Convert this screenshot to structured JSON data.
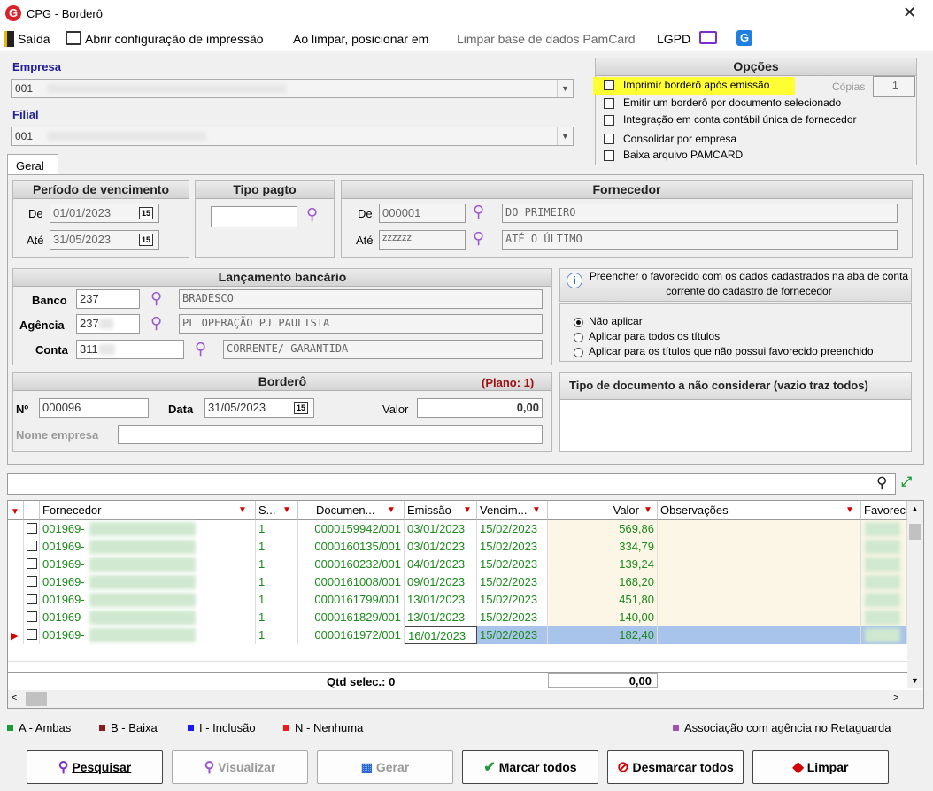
{
  "window": {
    "title": "CPG - Borderô",
    "close": "✕"
  },
  "menu": {
    "exit": "Saída",
    "print_config": "Abrir configuração de impressão",
    "on_clear": "Ao limpar, posicionar em",
    "clear_pamcard": "Limpar base de dados PamCard",
    "lgpd": "LGPD"
  },
  "empresa": {
    "label": "Empresa",
    "value": "001"
  },
  "filial": {
    "label": "Filial",
    "value": "001"
  },
  "opcoes": {
    "title": "Opções",
    "items": [
      "Imprimir borderô após emissão",
      "Emitir um borderô por documento selecionado",
      "Integração em conta contábil única de fornecedor",
      "Consolidar por empresa",
      "Baixa arquivo PAMCARD"
    ],
    "copias_label": "Cópias",
    "copias_value": "1"
  },
  "tabs": {
    "geral": "Geral"
  },
  "periodo": {
    "title": "Período de vencimento",
    "de_label": "De",
    "de_value": "01/01/2023",
    "ate_label": "Até",
    "ate_value": "31/05/2023",
    "cal": "15"
  },
  "tipo_pagto": {
    "title": "Tipo pagto"
  },
  "fornecedor": {
    "title": "Fornecedor",
    "de_label": "De",
    "de_code": "000001",
    "de_name": "DO PRIMEIRO",
    "ate_label": "Até",
    "ate_code": "zzzzzz",
    "ate_name": "ATÉ O ÚLTIMO"
  },
  "lancamento": {
    "title": "Lançamento bancário",
    "banco_label": "Banco",
    "banco_code": "237",
    "banco_name": "BRADESCO",
    "agencia_label": "Agência",
    "agencia_code": "237",
    "agencia_name": "PL OPERAÇÃO PJ PAULISTA",
    "conta_label": "Conta",
    "conta_code": "311",
    "conta_name": "CORRENTE/ GARANTIDA"
  },
  "favorecido": {
    "info": "Preencher o favorecido com os dados cadastrados na aba de conta corrente do cadastro de fornecedor",
    "options": [
      "Não aplicar",
      "Aplicar para todos os títulos",
      "Aplicar para os títulos que não possui favorecido preenchido"
    ]
  },
  "bordero": {
    "title": "Borderô",
    "plano": "(Plano: 1)",
    "num_label": "Nº",
    "num_value": "000096",
    "data_label": "Data",
    "data_value": "31/05/2023",
    "valor_label": "Valor",
    "valor_value": "0,00",
    "nome_empresa_label": "Nome empresa"
  },
  "tipo_doc": {
    "title": "Tipo de documento a não considerar (vazio traz todos)"
  },
  "grid": {
    "headers": {
      "fornecedor": "Fornecedor",
      "s": "S...",
      "documento": "Documen...",
      "emissao": "Emissão",
      "vencimento": "Vencim...",
      "valor": "Valor",
      "observacoes": "Observações",
      "favorecido": "Favorec"
    },
    "rows": [
      {
        "fornecedor": "001969-",
        "s": "1",
        "documento": "0000159942/001",
        "emissao": "03/01/2023",
        "vencimento": "15/02/2023",
        "valor": "569,86"
      },
      {
        "fornecedor": "001969-",
        "s": "1",
        "documento": "0000160135/001",
        "emissao": "03/01/2023",
        "vencimento": "15/02/2023",
        "valor": "334,79"
      },
      {
        "fornecedor": "001969-",
        "s": "1",
        "documento": "0000160232/001",
        "emissao": "04/01/2023",
        "vencimento": "15/02/2023",
        "valor": "139,24"
      },
      {
        "fornecedor": "001969-",
        "s": "1",
        "documento": "0000161008/001",
        "emissao": "09/01/2023",
        "vencimento": "15/02/2023",
        "valor": "168,20"
      },
      {
        "fornecedor": "001969-",
        "s": "1",
        "documento": "0000161799/001",
        "emissao": "13/01/2023",
        "vencimento": "15/02/2023",
        "valor": "451,80"
      },
      {
        "fornecedor": "001969-",
        "s": "1",
        "documento": "0000161829/001",
        "emissao": "13/01/2023",
        "vencimento": "15/02/2023",
        "valor": "140,00"
      },
      {
        "fornecedor": "001969-",
        "s": "1",
        "documento": "0000161972/001",
        "emissao": "16/01/2023",
        "vencimento": "15/02/2023",
        "valor": "182,40"
      }
    ],
    "footer": {
      "qtd_selec": "Qtd selec.: 0",
      "total": "0,00"
    }
  },
  "legend": {
    "a": "A - Ambas",
    "b": "B - Baixa",
    "i": "I - Inclusão",
    "n": "N - Nenhuma",
    "assoc": "Associação com agência no Retaguarda"
  },
  "buttons": {
    "pesquisar": "Pesquisar",
    "visualizar": "Visualizar",
    "gerar": "Gerar",
    "marcar": "Marcar todos",
    "desmarcar": "Desmarcar todos",
    "limpar": "Limpar"
  },
  "colors": {
    "selected_row": "#a9c4ea",
    "alt_row": "#fbf6e6",
    "highlight_option": "#ffff33",
    "legend_a": "#1a9a3a",
    "legend_b": "#8b1a1a",
    "legend_i": "#1a1aee",
    "legend_n": "#ee1a1a",
    "legend_assoc": "#a050b0"
  }
}
